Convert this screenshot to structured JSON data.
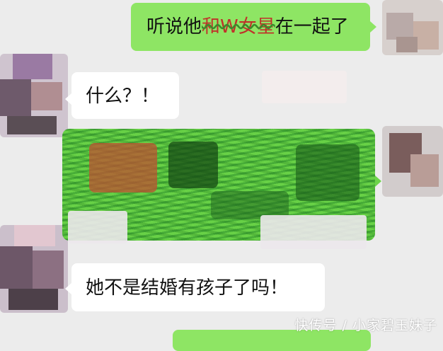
{
  "conversation": {
    "messages": [
      {
        "side": "right",
        "style": "green",
        "text_before": "听说他",
        "text_censored": "和W女星",
        "text_after": "在一起了"
      },
      {
        "side": "left",
        "style": "white",
        "text": "什么？！"
      },
      {
        "side": "right",
        "style": "green",
        "redacted": true
      },
      {
        "side": "left",
        "style": "white",
        "text": "她不是结婚有孩子了吗！"
      }
    ]
  },
  "watermark": "快传号 / 小家碧玉妹子",
  "colors": {
    "background": "#ececec",
    "sent_bubble": "#8ee564",
    "received_bubble": "#ffffff",
    "censor_ink": "#c0322a"
  }
}
